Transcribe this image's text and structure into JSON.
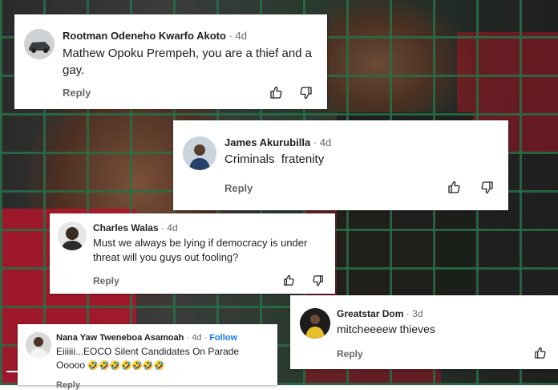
{
  "comments": [
    {
      "name": "Rootman Odeneho Kwarfo Akoto",
      "age": "4d",
      "text": "Mathew Opoku Prempeh, you are a thief and a gay.",
      "reply": "Reply"
    },
    {
      "name": "James Akurubilla",
      "age": "4d",
      "text": "Criminals  fratenity",
      "reply": "Reply"
    },
    {
      "name": "Charles Walas",
      "age": "4d",
      "text": "Must we always be lying if democracy is under threat will you guys out fooling?",
      "reply": "Reply"
    },
    {
      "name": "Greatstar Dom",
      "age": "3d",
      "text": "mitcheeeew thieves",
      "reply": "Reply"
    },
    {
      "name": "Nana Yaw Tweneboa Asamoah",
      "age": "4d",
      "follow": "Follow",
      "text1": "Eiiiiii...EOCO Silent Candidates On Parade",
      "text2": "Ooooo",
      "emojis": "🤣🤣🤣🤣🤣🤣🤣",
      "reply": "Reply"
    }
  ],
  "separator": "·",
  "icons": {
    "like": "thumbs-up-icon",
    "dislike": "thumbs-down-icon"
  },
  "colors": {
    "link": "#1877f2",
    "muted": "#65676b",
    "fence": "#2e7a4a"
  }
}
